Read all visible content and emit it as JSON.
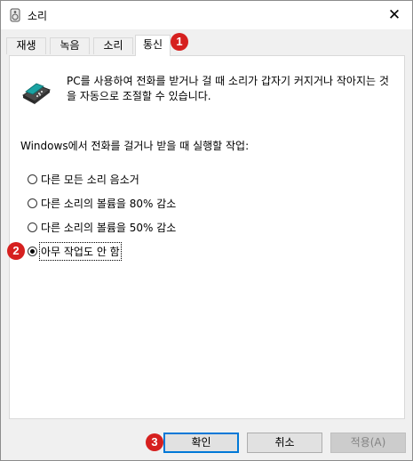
{
  "window": {
    "title": "소리",
    "close_glyph": "✕"
  },
  "tabs": [
    {
      "label": "재생"
    },
    {
      "label": "녹음"
    },
    {
      "label": "소리"
    },
    {
      "label": "통신"
    }
  ],
  "content": {
    "description": "PC를 사용하여 전화를 받거나 걸 때 소리가 갑자기 커지거나 작아지는 것을 자동으로 조절할 수 있습니다.",
    "question": "Windows에서 전화를 걸거나 받을 때 실행할 작업:",
    "options": [
      {
        "label": "다른 모든 소리 음소거",
        "checked": false
      },
      {
        "label": "다른 소리의 볼륨을 80% 감소",
        "checked": false
      },
      {
        "label": "다른 소리의 볼륨을 50% 감소",
        "checked": false
      },
      {
        "label": "아무 작업도 안 함",
        "checked": true
      }
    ]
  },
  "buttons": {
    "ok": "확인",
    "cancel": "취소",
    "apply": "적용(A)"
  },
  "badges": [
    "1",
    "2",
    "3"
  ],
  "colors": {
    "badge": "#d6201f",
    "primary_border": "#0078d7"
  }
}
